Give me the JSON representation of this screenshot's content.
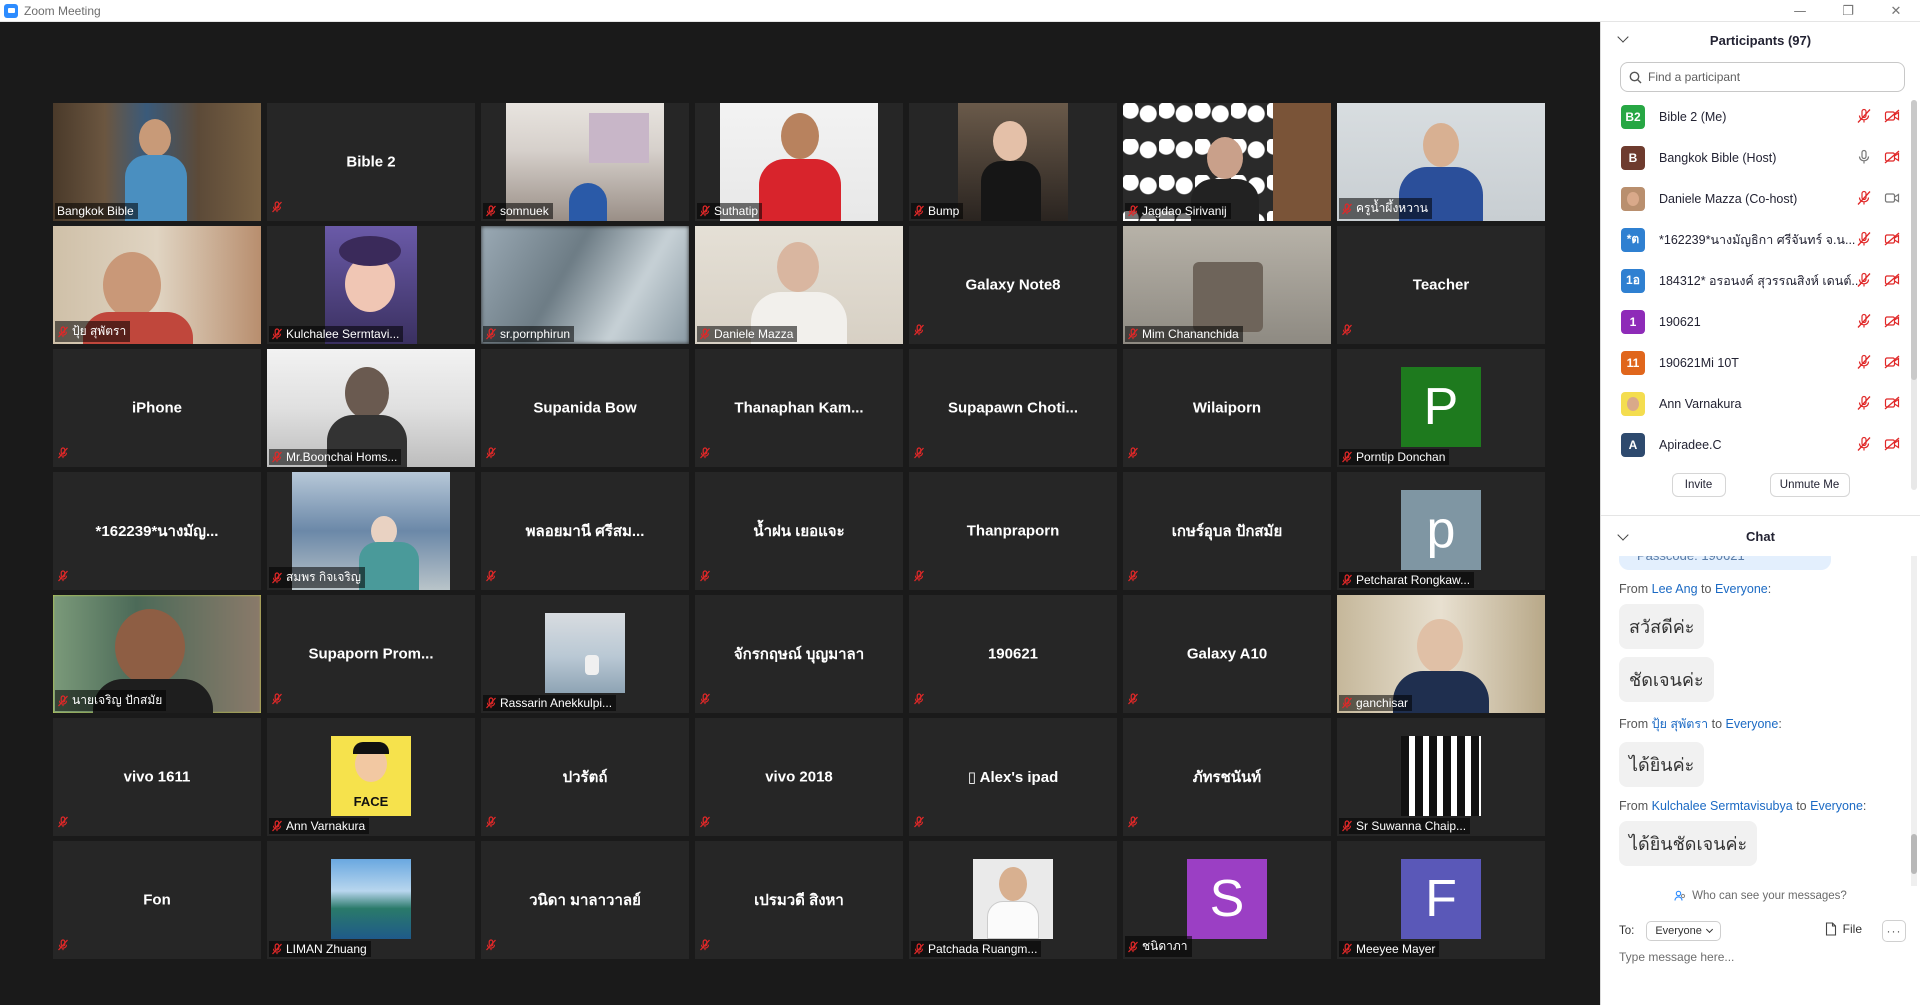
{
  "window": {
    "title": "Zoom Meeting",
    "minimize": "—",
    "restore": "❐",
    "close": "✕"
  },
  "tiles": [
    {
      "label": "Bangkok Bible",
      "kind": "video",
      "scene": "library",
      "muted": false
    },
    {
      "center": "Bible 2",
      "kind": "name",
      "muted": true
    },
    {
      "label": "somnuek",
      "kind": "video",
      "scene": "room",
      "muted": true
    },
    {
      "label": "Suthatip",
      "kind": "video",
      "scene": "red",
      "muted": true
    },
    {
      "label": "Bump",
      "kind": "video",
      "scene": "dark",
      "muted": true
    },
    {
      "label": "Jagdao Sirivanij",
      "kind": "video",
      "scene": "wallpaper",
      "muted": true
    },
    {
      "label": "ครูน้ำผึ้งหวาน",
      "kind": "video",
      "scene": "blue",
      "muted": true
    },
    {
      "label": "ปุ้ย สุพัตรา",
      "kind": "video",
      "scene": "warm",
      "muted": true
    },
    {
      "label": "Kulchalee Sermtavi...",
      "kind": "video",
      "scene": "art",
      "muted": true
    },
    {
      "label": "sr.pornphirun",
      "kind": "video",
      "scene": "blur",
      "muted": true
    },
    {
      "label": "Daniele Mazza",
      "kind": "video",
      "scene": "beige",
      "muted": true
    },
    {
      "center": "Galaxy Note8",
      "kind": "name",
      "muted": true
    },
    {
      "label": "Mim Chananchida",
      "kind": "video",
      "scene": "grey",
      "muted": true
    },
    {
      "center": "Teacher",
      "kind": "name",
      "muted": true
    },
    {
      "center": "iPhone",
      "kind": "name",
      "muted": true
    },
    {
      "label": "Mr.Boonchai Homs...",
      "kind": "video",
      "scene": "window",
      "muted": true
    },
    {
      "center": "Supanida Bow",
      "kind": "name",
      "muted": true
    },
    {
      "center": "Thanaphan  Kam...",
      "kind": "name",
      "muted": true
    },
    {
      "center": "Supapawn  Choti...",
      "kind": "name",
      "muted": true
    },
    {
      "center": "Wilaiporn",
      "kind": "name",
      "muted": true
    },
    {
      "label": "Porntip Donchan",
      "kind": "letter",
      "letter": "P",
      "color": "#1e7a1e",
      "muted": true
    },
    {
      "center": "*162239*นางมัญ...",
      "kind": "name",
      "muted": true
    },
    {
      "label": "สมพร กิจเจริญ",
      "kind": "video",
      "scene": "ceiling",
      "muted": true
    },
    {
      "center": "พลอยมานี ศรีสม...",
      "kind": "name",
      "muted": true
    },
    {
      "center": "น้ำฝน เยอแจะ",
      "kind": "name",
      "muted": true
    },
    {
      "center": "Thanpraporn",
      "kind": "name",
      "muted": true
    },
    {
      "center": "เกษร์อุบล ปักสมัย",
      "kind": "name",
      "muted": true
    },
    {
      "label": "Petcharat Rongkaw...",
      "kind": "letter",
      "letter": "p",
      "color": "#7f96a3",
      "muted": true
    },
    {
      "label": "นายเจริญ ปักสมัย",
      "kind": "video",
      "scene": "man",
      "muted": true,
      "active": true
    },
    {
      "center": "Supaporn  Prom...",
      "kind": "name",
      "muted": true
    },
    {
      "label": "Rassarin Anekkulpi...",
      "kind": "thumb",
      "scene": "sea",
      "muted": true
    },
    {
      "center": "จักรกฤษณ์ บุญมาลา",
      "kind": "name",
      "muted": true
    },
    {
      "center": "190621",
      "kind": "name",
      "muted": true
    },
    {
      "center": "Galaxy A10",
      "kind": "name",
      "muted": true
    },
    {
      "label": "ganchisar",
      "kind": "video",
      "scene": "home",
      "muted": true
    },
    {
      "center": "vivo 1611",
      "kind": "name",
      "muted": true
    },
    {
      "label": "Ann Varnakura",
      "kind": "square",
      "scene": "face-logo",
      "logo": "FACE",
      "muted": true
    },
    {
      "center": "ปวรัตถ์",
      "kind": "name",
      "muted": true
    },
    {
      "center": "vivo 2018",
      "kind": "name",
      "muted": true
    },
    {
      "center": "▯ Alex's  ipad",
      "kind": "name",
      "muted": true
    },
    {
      "center": "ภัทรชนันท์",
      "kind": "name",
      "muted": true
    },
    {
      "label": "Sr Suwanna Chaip...",
      "kind": "square",
      "scene": "nuns",
      "muted": true
    },
    {
      "center": "Fon",
      "kind": "name",
      "muted": true
    },
    {
      "label": "LIMAN Zhuang",
      "kind": "square",
      "scene": "island",
      "muted": true
    },
    {
      "center": "วนิดา มาลาวาลย์",
      "kind": "name",
      "muted": true
    },
    {
      "center": "เปรมวดี สิงหา",
      "kind": "name",
      "muted": true
    },
    {
      "label": "Patchada Ruangm...",
      "kind": "square",
      "scene": "portrait",
      "muted": true
    },
    {
      "label": "ชนิดาภา",
      "kind": "letter",
      "letter": "S",
      "color": "#9b3fc4",
      "muted": true
    },
    {
      "label": "Meeyee Mayer",
      "kind": "letter",
      "letter": "F",
      "color": "#5a58b8",
      "muted": true
    }
  ],
  "participants": {
    "title": "Participants (97)",
    "search_placeholder": "Find a participant",
    "list": [
      {
        "badge": "B2",
        "color": "#27a744",
        "name": "Bible 2 (Me)",
        "mic": "off",
        "cam": "off"
      },
      {
        "badge": "B",
        "color": "#6e3b2e",
        "name": "Bangkok Bible (Host)",
        "mic": "on",
        "cam": "off"
      },
      {
        "badge": "",
        "color": "#b98f6e",
        "name": "Daniele Mazza (Co-host)",
        "mic": "off",
        "cam": "on"
      },
      {
        "badge": "*ต",
        "color": "#2f80d1",
        "name": "*162239*นางมัญธิกา  ศรีจันทร์ จ.น...",
        "mic": "off",
        "cam": "off"
      },
      {
        "badge": "1อ",
        "color": "#2f80d1",
        "name": "184312* อรอนงค์ สุวรรณสิงห์ เดนต์...",
        "mic": "off",
        "cam": "off"
      },
      {
        "badge": "1",
        "color": "#8e2bb8",
        "name": "190621",
        "mic": "off",
        "cam": "off"
      },
      {
        "badge": "11",
        "color": "#e0661c",
        "name": "190621Mi 10T",
        "mic": "off",
        "cam": "off"
      },
      {
        "badge": "",
        "color": "#f4dd4f",
        "name": "Ann Varnakura",
        "mic": "off",
        "cam": "off"
      },
      {
        "badge": "A",
        "color": "#2e4a6e",
        "name": "Apiradee.C",
        "mic": "off",
        "cam": "off"
      }
    ],
    "invite": "Invite",
    "unmute_me": "Unmute Me"
  },
  "chat": {
    "title": "Chat",
    "prev_fragment": "Passcode: 190621",
    "messages": [
      {
        "from": "Lee Ang",
        "to": "Everyone",
        "from_prefix": "From",
        "to_prefix": "to",
        "bubbles": [
          "สวัสดีค่ะ",
          "ชัดเจนค่ะ"
        ]
      },
      {
        "from": "ปุ้ย สุพัตรา",
        "to": "Everyone",
        "from_prefix": "From",
        "to_prefix": "to",
        "bubbles": [
          "ได้ยินค่ะ"
        ]
      },
      {
        "from": "Kulchalee Sermtavisubya",
        "to": "Everyone",
        "from_prefix": "From",
        "to_prefix": "to",
        "bubbles": [
          "ได้ยินชัดเจนค่ะ"
        ]
      }
    ],
    "who_can_see": "Who can see your messages?",
    "to_label": "To:",
    "to_value": "Everyone",
    "file_label": "File",
    "more": "···",
    "input_placeholder": "Type message here..."
  }
}
